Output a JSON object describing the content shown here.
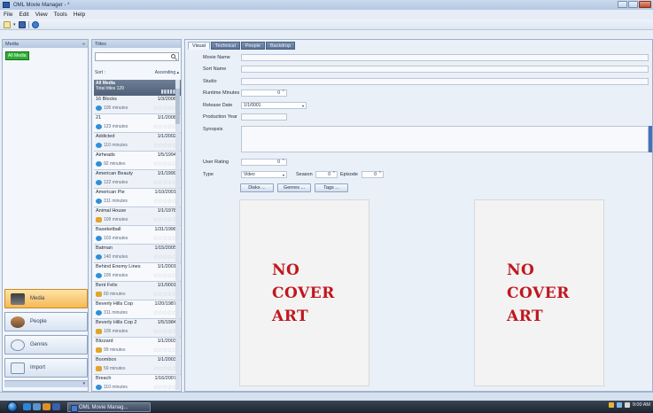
{
  "window": {
    "title": "OML Movie Manager - *"
  },
  "menu": [
    "File",
    "Edit",
    "View",
    "Tools",
    "Help"
  ],
  "left_pane": {
    "header": "Media",
    "collapse_glyph": "«",
    "all_media_chip": "All Media",
    "nav": [
      {
        "label": "Media",
        "icon": "clapperboard-icon",
        "active": true
      },
      {
        "label": "People",
        "icon": "people-icon",
        "active": false
      },
      {
        "label": "Genres",
        "icon": "genres-icon",
        "active": false
      },
      {
        "label": "Import",
        "icon": "import-icon",
        "active": false
      }
    ]
  },
  "titles_pane": {
    "header": "Titles",
    "search_placeholder": "",
    "sort_label": "Sort :",
    "sort_order": "Ascending ▴",
    "group": {
      "name": "All Media",
      "total": "Total titles 129"
    },
    "items": [
      {
        "title": "16 Blocks",
        "date": "1/3/2006",
        "runtime": "105 minutes",
        "badge": "blue"
      },
      {
        "title": "21",
        "date": "1/1/2008",
        "runtime": "123 minutes",
        "badge": "blue"
      },
      {
        "title": "Addicted",
        "date": "1/1/2002",
        "runtime": "110 minutes",
        "badge": "blue"
      },
      {
        "title": "Airheads",
        "date": "1/5/1994",
        "runtime": "92 minutes",
        "badge": "blue"
      },
      {
        "title": "American Beauty",
        "date": "1/1/1999",
        "runtime": "122 minutes",
        "badge": "blue"
      },
      {
        "title": "American Pie",
        "date": "1/10/2001",
        "runtime": "311 minutes",
        "badge": "blue"
      },
      {
        "title": "Animal House",
        "date": "1/1/1978",
        "runtime": "109 minutes",
        "badge": "dvd"
      },
      {
        "title": "Baseketball",
        "date": "1/31/1998",
        "runtime": "103 minutes",
        "badge": "blue"
      },
      {
        "title": "Batman",
        "date": "1/15/2005",
        "runtime": "140 minutes",
        "badge": "blue"
      },
      {
        "title": "Behind Enemy Lines",
        "date": "1/1/2001",
        "runtime": "105 minutes",
        "badge": "blue"
      },
      {
        "title": "Bent Felix",
        "date": "1/1/0001",
        "runtime": "60 minutes",
        "badge": "dvd"
      },
      {
        "title": "Beverly Hills Cop",
        "date": "1/20/1987",
        "runtime": "311 minutes",
        "badge": "blue"
      },
      {
        "title": "Beverly Hills Cop 2",
        "date": "1/5/1984",
        "runtime": "105 minutes",
        "badge": "dvd"
      },
      {
        "title": "Blizzard",
        "date": "1/1/2003",
        "runtime": "99 minutes",
        "badge": "dvd"
      },
      {
        "title": "Boombox",
        "date": "1/1/2003",
        "runtime": "59 minutes",
        "badge": "dvd"
      },
      {
        "title": "Breach",
        "date": "1/16/2007",
        "runtime": "110 minutes",
        "badge": "blue"
      },
      {
        "title": "Bridget Jones The...",
        "date": "1/19/2004",
        "runtime": "",
        "badge": ""
      }
    ]
  },
  "details": {
    "tabs": [
      "Visual",
      "Technical",
      "People",
      "Backdrop"
    ],
    "labels": {
      "movie_name": "Movie Name",
      "sort_name": "Sort Name",
      "studio": "Studio",
      "runtime": "Runtime Minutes",
      "release_date": "Release Date",
      "production_year": "Production Year",
      "synopsis": "Synopsis",
      "user_rating": "User Rating",
      "type": "Type",
      "season": "Season",
      "episode": "Episode"
    },
    "values": {
      "runtime": "0",
      "release_date": "1/1/0001",
      "user_rating": "0",
      "type": "Video",
      "season": "0",
      "episode": "0"
    },
    "buttons": {
      "disks": "Disks ...",
      "genres": "Genres ...",
      "tags": "Tags ..."
    },
    "cover_text": "NO\nCOVER\nART"
  },
  "taskbar": {
    "task": "OML Movie Manag...",
    "clock": "9:00 AM"
  },
  "colors": {
    "accent": "#5b7398",
    "active_nav": "#f7b955",
    "no_cover_red": "#c0171e",
    "all_media_green": "#2fae35"
  }
}
